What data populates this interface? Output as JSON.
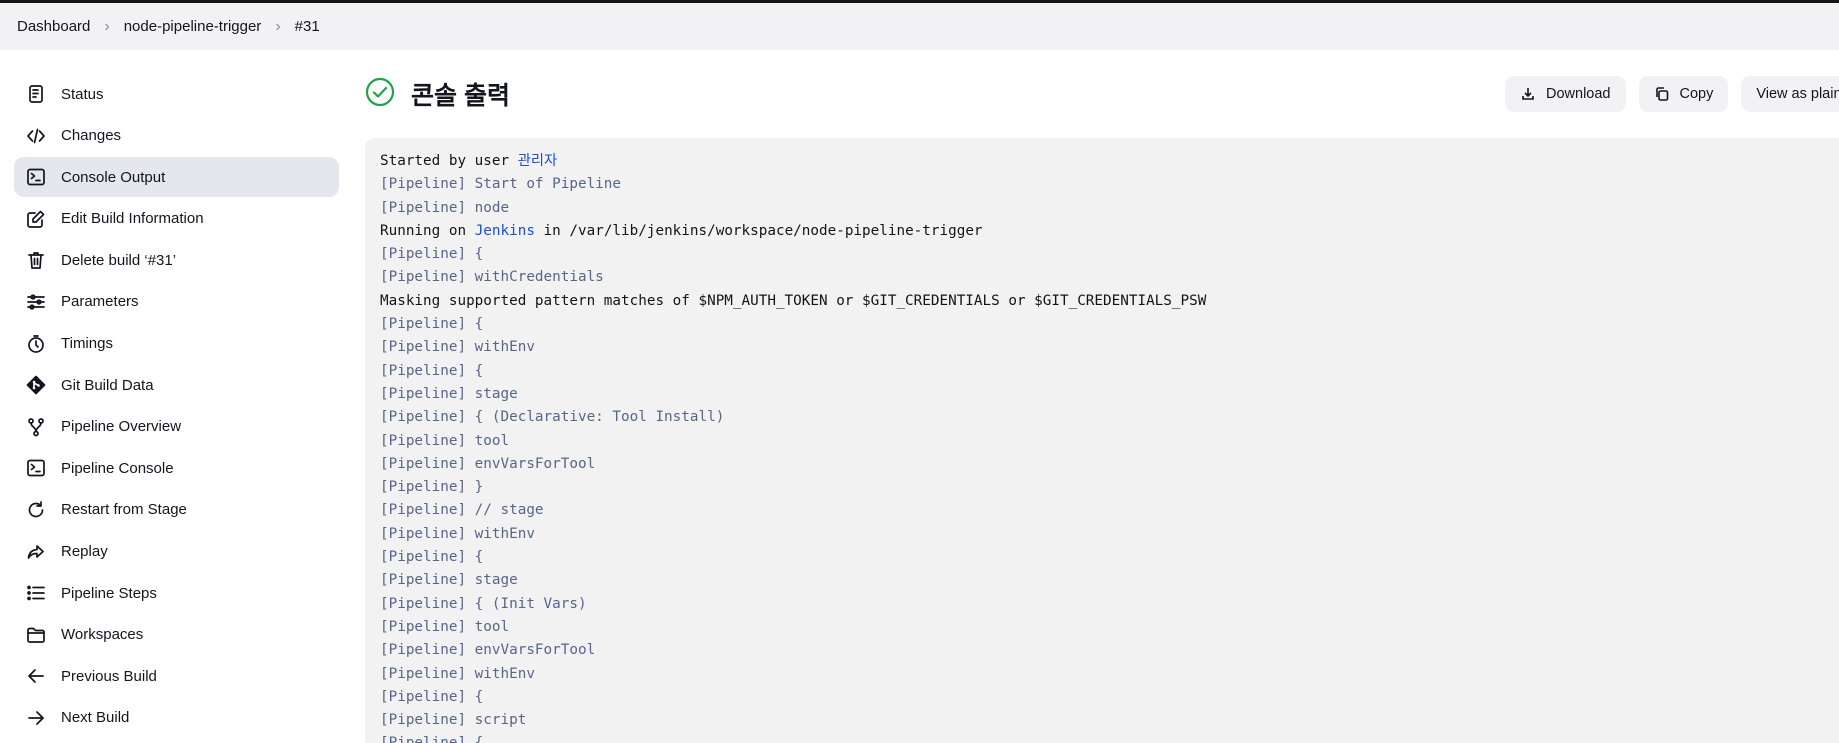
{
  "breadcrumb": [
    "Dashboard",
    "node-pipeline-trigger",
    "#31"
  ],
  "sidebar": {
    "items": [
      {
        "label": "Status",
        "icon": "document-icon",
        "active": false
      },
      {
        "label": "Changes",
        "icon": "code-icon",
        "active": false
      },
      {
        "label": "Console Output",
        "icon": "terminal-icon",
        "active": true
      },
      {
        "label": "Edit Build Information",
        "icon": "edit-icon",
        "active": false
      },
      {
        "label": "Delete build ‘#31’",
        "icon": "trash-icon",
        "active": false
      },
      {
        "label": "Parameters",
        "icon": "sliders-icon",
        "active": false
      },
      {
        "label": "Timings",
        "icon": "stopwatch-icon",
        "active": false
      },
      {
        "label": "Git Build Data",
        "icon": "git-icon",
        "active": false
      },
      {
        "label": "Pipeline Overview",
        "icon": "branch-icon",
        "active": false
      },
      {
        "label": "Pipeline Console",
        "icon": "terminal-icon",
        "active": false
      },
      {
        "label": "Restart from Stage",
        "icon": "restart-icon",
        "active": false
      },
      {
        "label": "Replay",
        "icon": "replay-icon",
        "active": false
      },
      {
        "label": "Pipeline Steps",
        "icon": "list-icon",
        "active": false
      },
      {
        "label": "Workspaces",
        "icon": "folder-icon",
        "active": false
      },
      {
        "label": "Previous Build",
        "icon": "arrow-left-icon",
        "active": false
      },
      {
        "label": "Next Build",
        "icon": "arrow-right-icon",
        "active": false
      }
    ]
  },
  "page": {
    "title": "콘솔 출력",
    "status_color": "#1ea446"
  },
  "actions": {
    "download": "Download",
    "copy": "Copy",
    "view_plain": "View as plain"
  },
  "console": {
    "lines": [
      {
        "kind": "plain",
        "parts": [
          {
            "t": "Started by user "
          },
          {
            "t": "관리자",
            "link": true
          }
        ]
      },
      {
        "kind": "pipe",
        "parts": [
          {
            "t": "[Pipeline] Start of Pipeline"
          }
        ]
      },
      {
        "kind": "pipe",
        "parts": [
          {
            "t": "[Pipeline] node"
          }
        ]
      },
      {
        "kind": "plain",
        "parts": [
          {
            "t": "Running on "
          },
          {
            "t": "Jenkins",
            "link": true
          },
          {
            "t": " in /var/lib/jenkins/workspace/node-pipeline-trigger"
          }
        ]
      },
      {
        "kind": "pipe",
        "parts": [
          {
            "t": "[Pipeline] {"
          }
        ]
      },
      {
        "kind": "pipe",
        "parts": [
          {
            "t": "[Pipeline] withCredentials"
          }
        ]
      },
      {
        "kind": "plain",
        "parts": [
          {
            "t": "Masking supported pattern matches of $NPM_AUTH_TOKEN or $GIT_CREDENTIALS or $GIT_CREDENTIALS_PSW"
          }
        ]
      },
      {
        "kind": "pipe",
        "parts": [
          {
            "t": "[Pipeline] {"
          }
        ]
      },
      {
        "kind": "pipe",
        "parts": [
          {
            "t": "[Pipeline] withEnv"
          }
        ]
      },
      {
        "kind": "pipe",
        "parts": [
          {
            "t": "[Pipeline] {"
          }
        ]
      },
      {
        "kind": "pipe",
        "parts": [
          {
            "t": "[Pipeline] stage"
          }
        ]
      },
      {
        "kind": "pipe",
        "parts": [
          {
            "t": "[Pipeline] { (Declarative: Tool Install)"
          }
        ]
      },
      {
        "kind": "pipe",
        "parts": [
          {
            "t": "[Pipeline] tool"
          }
        ]
      },
      {
        "kind": "pipe",
        "parts": [
          {
            "t": "[Pipeline] envVarsForTool"
          }
        ]
      },
      {
        "kind": "pipe",
        "parts": [
          {
            "t": "[Pipeline] }"
          }
        ]
      },
      {
        "kind": "pipe",
        "parts": [
          {
            "t": "[Pipeline] // stage"
          }
        ]
      },
      {
        "kind": "pipe",
        "parts": [
          {
            "t": "[Pipeline] withEnv"
          }
        ]
      },
      {
        "kind": "pipe",
        "parts": [
          {
            "t": "[Pipeline] {"
          }
        ]
      },
      {
        "kind": "pipe",
        "parts": [
          {
            "t": "[Pipeline] stage"
          }
        ]
      },
      {
        "kind": "pipe",
        "parts": [
          {
            "t": "[Pipeline] { (Init Vars)"
          }
        ]
      },
      {
        "kind": "pipe",
        "parts": [
          {
            "t": "[Pipeline] tool"
          }
        ]
      },
      {
        "kind": "pipe",
        "parts": [
          {
            "t": "[Pipeline] envVarsForTool"
          }
        ]
      },
      {
        "kind": "pipe",
        "parts": [
          {
            "t": "[Pipeline] withEnv"
          }
        ]
      },
      {
        "kind": "pipe",
        "parts": [
          {
            "t": "[Pipeline] {"
          }
        ]
      },
      {
        "kind": "pipe",
        "parts": [
          {
            "t": "[Pipeline] script"
          }
        ]
      },
      {
        "kind": "pipe",
        "parts": [
          {
            "t": "[Pipeline] {"
          }
        ]
      }
    ]
  }
}
